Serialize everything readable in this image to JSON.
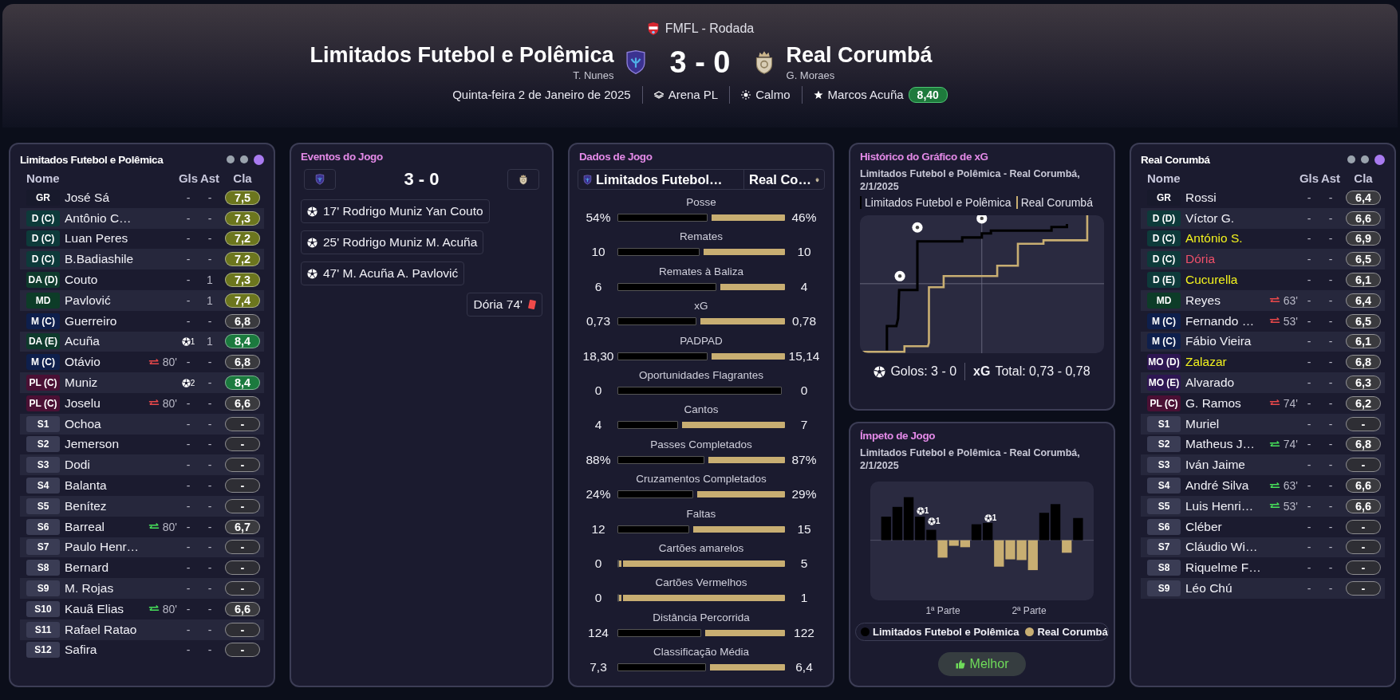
{
  "header": {
    "competition": "FMFL - Rodada",
    "home": {
      "name": "Limitados Futebol e Polêmica",
      "manager": "T. Nunes"
    },
    "score": "3 - 0",
    "away": {
      "name": "Real Corumbá",
      "manager": "G. Moraes"
    },
    "info": [
      {
        "kind": "date",
        "text": "Quinta-feira 2 de Janeiro de 2025"
      },
      {
        "kind": "stadium",
        "text": "Arena PL"
      },
      {
        "kind": "weather",
        "text": "Calmo"
      },
      {
        "kind": "motm",
        "text": "Marcos Acuña",
        "rating": "8,40"
      }
    ]
  },
  "home_lineup": {
    "title": "Limitados Futebol e Polêmica",
    "page_dots": [
      {
        "selected": false
      },
      {
        "selected": false
      },
      {
        "selected": true
      }
    ],
    "columns": [
      "Nome",
      "Gls",
      "Ast",
      "Cla"
    ],
    "players": [
      {
        "pos": {
          "text": "GR",
          "color": "#181a2c"
        },
        "name": "José Sá",
        "yellow_card": false,
        "red_card": false,
        "goal_icon": false,
        "goals": "-",
        "assists": "-",
        "rating": {
          "text": "7,5",
          "color": "#6c761e"
        }
      },
      {
        "pos": {
          "text": "D (C)",
          "color": "#0d3a3a"
        },
        "name": "Antônio C…",
        "yellow_card": false,
        "red_card": false,
        "goal_icon": false,
        "goals": "-",
        "assists": "-",
        "rating": {
          "text": "7,3",
          "color": "#6c761e"
        }
      },
      {
        "pos": {
          "text": "D (C)",
          "color": "#0d3a3a"
        },
        "name": "Luan Peres",
        "yellow_card": false,
        "red_card": false,
        "goal_icon": false,
        "goals": "-",
        "assists": "-",
        "rating": {
          "text": "7,2",
          "color": "#6c761e"
        }
      },
      {
        "pos": {
          "text": "D (C)",
          "color": "#0d3a3a"
        },
        "name": "B.Badiashile",
        "yellow_card": false,
        "red_card": false,
        "goal_icon": false,
        "goals": "-",
        "assists": "-",
        "rating": {
          "text": "7,2",
          "color": "#6c761e"
        }
      },
      {
        "pos": {
          "text": "DA (D)",
          "color": "#0e3a2c"
        },
        "name": "Couto",
        "yellow_card": false,
        "red_card": false,
        "goal_icon": false,
        "goals": "-",
        "assists": "1",
        "rating": {
          "text": "7,3",
          "color": "#6c761e"
        }
      },
      {
        "pos": {
          "text": "MD",
          "color": "#0d3c28"
        },
        "name": "Pavlović",
        "yellow_card": false,
        "red_card": false,
        "goal_icon": false,
        "goals": "-",
        "assists": "1",
        "rating": {
          "text": "7,4",
          "color": "#6c761e"
        }
      },
      {
        "pos": {
          "text": "M (C)",
          "color": "#0e1f4c"
        },
        "name": "Guerreiro",
        "yellow_card": false,
        "red_card": false,
        "goal_icon": false,
        "goals": "-",
        "assists": "-",
        "rating": {
          "text": "6,8",
          "color": "#3a3a3e"
        }
      },
      {
        "pos": {
          "text": "DA (E)",
          "color": "#0e3a2c"
        },
        "name": "Acuña",
        "yellow_card": false,
        "red_card": false,
        "goal_icon": true,
        "goals": "1",
        "assists": "1",
        "rating": {
          "text": "8,4",
          "color": "#1b7a3e"
        }
      },
      {
        "pos": {
          "text": "M (C)",
          "color": "#0e1f4c"
        },
        "name": "Otávio",
        "yellow_card": false,
        "red_card": false,
        "sub": {
          "minute": "80'",
          "incoming": false
        },
        "goal_icon": false,
        "goals": "-",
        "assists": "-",
        "rating": {
          "text": "6,8",
          "color": "#3a3a3e"
        }
      },
      {
        "pos": {
          "text": "PL (C)",
          "color": "#4a1034"
        },
        "name": "Muniz",
        "yellow_card": false,
        "red_card": false,
        "goal_icon": true,
        "goals": "2",
        "assists": "-",
        "rating": {
          "text": "8,4",
          "color": "#1b7a3e"
        }
      },
      {
        "pos": {
          "text": "PL (C)",
          "color": "#4a1034"
        },
        "name": "Joselu",
        "yellow_card": false,
        "red_card": false,
        "sub": {
          "minute": "80'",
          "incoming": false
        },
        "goal_icon": false,
        "goals": "-",
        "assists": "-",
        "rating": {
          "text": "6,6",
          "color": "#3a3a3e"
        }
      },
      {
        "pos": {
          "text": "S1",
          "color": "#3a3c54"
        },
        "name": "Ochoa",
        "yellow_card": false,
        "red_card": false,
        "goal_icon": false,
        "goals": "-",
        "assists": "-",
        "rating": {
          "text": "-",
          "color": "#2e2e34"
        }
      },
      {
        "pos": {
          "text": "S2",
          "color": "#3a3c54"
        },
        "name": "Jemerson",
        "yellow_card": false,
        "red_card": false,
        "goal_icon": false,
        "goals": "-",
        "assists": "-",
        "rating": {
          "text": "-",
          "color": "#2e2e34"
        }
      },
      {
        "pos": {
          "text": "S3",
          "color": "#3a3c54"
        },
        "name": "Dodi",
        "yellow_card": false,
        "red_card": false,
        "goal_icon": false,
        "goals": "-",
        "assists": "-",
        "rating": {
          "text": "-",
          "color": "#2e2e34"
        }
      },
      {
        "pos": {
          "text": "S4",
          "color": "#3a3c54"
        },
        "name": "Balanta",
        "yellow_card": false,
        "red_card": false,
        "goal_icon": false,
        "goals": "-",
        "assists": "-",
        "rating": {
          "text": "-",
          "color": "#2e2e34"
        }
      },
      {
        "pos": {
          "text": "S5",
          "color": "#3a3c54"
        },
        "name": "Benítez",
        "yellow_card": false,
        "red_card": false,
        "goal_icon": false,
        "goals": "-",
        "assists": "-",
        "rating": {
          "text": "-",
          "color": "#2e2e34"
        }
      },
      {
        "pos": {
          "text": "S6",
          "color": "#3a3c54"
        },
        "name": "Barreal",
        "yellow_card": false,
        "red_card": false,
        "sub": {
          "minute": "80'",
          "incoming": true
        },
        "goal_icon": false,
        "goals": "-",
        "assists": "-",
        "rating": {
          "text": "6,7",
          "color": "#3a3a3e"
        }
      },
      {
        "pos": {
          "text": "S7",
          "color": "#3a3c54"
        },
        "name": "Paulo Henr…",
        "yellow_card": false,
        "red_card": false,
        "goal_icon": false,
        "goals": "-",
        "assists": "-",
        "rating": {
          "text": "-",
          "color": "#2e2e34"
        }
      },
      {
        "pos": {
          "text": "S8",
          "color": "#3a3c54"
        },
        "name": "Bernard",
        "yellow_card": false,
        "red_card": false,
        "goal_icon": false,
        "goals": "-",
        "assists": "-",
        "rating": {
          "text": "-",
          "color": "#2e2e34"
        }
      },
      {
        "pos": {
          "text": "S9",
          "color": "#3a3c54"
        },
        "name": "M. Rojas",
        "yellow_card": false,
        "red_card": false,
        "goal_icon": false,
        "goals": "-",
        "assists": "-",
        "rating": {
          "text": "-",
          "color": "#2e2e34"
        }
      },
      {
        "pos": {
          "text": "S10",
          "color": "#3a3c54"
        },
        "name": "Kauã Elias",
        "yellow_card": false,
        "red_card": false,
        "sub": {
          "minute": "80'",
          "incoming": true
        },
        "goal_icon": false,
        "goals": "-",
        "assists": "-",
        "rating": {
          "text": "6,6",
          "color": "#3a3a3e"
        }
      },
      {
        "pos": {
          "text": "S11",
          "color": "#3a3c54"
        },
        "name": "Rafael Ratao",
        "yellow_card": false,
        "red_card": false,
        "goal_icon": false,
        "goals": "-",
        "assists": "-",
        "rating": {
          "text": "-",
          "color": "#2e2e34"
        }
      },
      {
        "pos": {
          "text": "S12",
          "color": "#3a3c54"
        },
        "name": "Safira",
        "yellow_card": false,
        "red_card": false,
        "goal_icon": false,
        "goals": "-",
        "assists": "-",
        "rating": {
          "text": "-",
          "color": "#2e2e34"
        }
      }
    ]
  },
  "events": {
    "title": "Eventos do Jogo",
    "score": "3 - 0",
    "items": [
      {
        "kind": "goal",
        "away": false,
        "text": "17' Rodrigo Muniz Yan Couto"
      },
      {
        "kind": "goal",
        "away": false,
        "text": "25' Rodrigo Muniz M. Acuña"
      },
      {
        "kind": "goal",
        "away": false,
        "text": "47' M. Acuña A. Pavlović"
      },
      {
        "kind": "red_card",
        "away": true,
        "text": "Dória 74'"
      }
    ]
  },
  "match_stats": {
    "title": "Dados de Jogo",
    "home_team": "Limitados Futebol…",
    "away_team": "Real Co…",
    "stats": [
      {
        "label": "Posse",
        "home": "54%",
        "away": "46%",
        "level": 0.54
      },
      {
        "label": "Remates",
        "home": "10",
        "away": "10",
        "level": 0.49
      },
      {
        "label": "Remates à Baliza",
        "home": "6",
        "away": "4",
        "level": 0.59
      },
      {
        "label": "xG",
        "home": "0,73",
        "away": "0,78",
        "level": 0.47
      },
      {
        "label": "PADPAD",
        "home": "18,30",
        "away": "15,14",
        "level": 0.54
      },
      {
        "label": "Oportunidades Flagrantes",
        "home": "0",
        "away": "0",
        "level": 0.98
      },
      {
        "label": "Cantos",
        "home": "4",
        "away": "7",
        "level": 0.36
      },
      {
        "label": "Passes Completados",
        "home": "88%",
        "away": "87%",
        "level": 0.52
      },
      {
        "label": "Cruzamentos Completados",
        "home": "24%",
        "away": "29%",
        "level": 0.45
      },
      {
        "label": "Faltas",
        "home": "12",
        "away": "15",
        "level": 0.43
      },
      {
        "label": "Cartões amarelos",
        "home": "0",
        "away": "5",
        "level": 0.01
      },
      {
        "label": "Cartões Vermelhos",
        "home": "0",
        "away": "1",
        "level": 0.01
      },
      {
        "label": "Distância Percorrida",
        "home": "124",
        "away": "122",
        "level": 0.5
      },
      {
        "label": "Classificação Média",
        "home": "7,3",
        "away": "6,4",
        "level": 0.53
      }
    ]
  },
  "xg_history": {
    "title": "Histórico do Gráfico de xG",
    "subtitle": "Limitados Futebol e Polêmica - Real Corumbá, 2/1/2025",
    "legend": [
      {
        "label": "Limitados Futebol e Polêmica",
        "color": "#000000"
      },
      {
        "label": "Real Corumbá",
        "color": "#c8ae72"
      }
    ],
    "goals": "Golos: 3 - 0",
    "xg_total": "**xG** Total: 0,73 - 0,78"
  },
  "momentum": {
    "title": "Ímpeto de Jogo",
    "subtitle": "Limitados Futebol e Polêmica - Real Corumbá, 2/1/2025",
    "goal_markers": [
      {
        "count": "1"
      },
      {
        "count": "1"
      },
      {
        "count": "1"
      }
    ],
    "halves": [
      "1ª Parte",
      "2ª Parte"
    ],
    "legend": [
      {
        "label": "Limitados Futebol e Polêmica",
        "color": "#000000"
      },
      {
        "label": "Real Corumbá",
        "color": "#c8ae72"
      }
    ],
    "button": "Melhor"
  },
  "away_lineup": {
    "title": "Real Corumbá",
    "page_dots": [
      {
        "selected": false
      },
      {
        "selected": false
      },
      {
        "selected": true
      }
    ],
    "columns": [
      "Nome",
      "Gls",
      "Ast",
      "Cla"
    ],
    "players": [
      {
        "pos": {
          "text": "GR",
          "color": "#181a2c"
        },
        "name": "Rossi",
        "yellow_card": false,
        "red_card": false,
        "goal_icon": false,
        "goals": "-",
        "assists": "-",
        "rating": {
          "text": "6,4",
          "color": "#3a3a3e"
        }
      },
      {
        "pos": {
          "text": "D (D)",
          "color": "#0d3a3a"
        },
        "name": "Víctor G.",
        "yellow_card": false,
        "red_card": false,
        "goal_icon": false,
        "goals": "-",
        "assists": "-",
        "rating": {
          "text": "6,6",
          "color": "#3a3a3e"
        }
      },
      {
        "pos": {
          "text": "D (C)",
          "color": "#0d3a3a"
        },
        "name": "António S.",
        "yellow_card": true,
        "red_card": false,
        "goal_icon": false,
        "goals": "-",
        "assists": "-",
        "rating": {
          "text": "6,9",
          "color": "#3a3a3e"
        }
      },
      {
        "pos": {
          "text": "D (C)",
          "color": "#0d3a3a"
        },
        "name": "Dória",
        "red_card": true,
        "goal_icon": false,
        "goals": "-",
        "assists": "-",
        "rating": {
          "text": "6,5",
          "color": "#3a3a3e"
        }
      },
      {
        "pos": {
          "text": "D (E)",
          "color": "#0d3a3a"
        },
        "name": "Cucurella",
        "yellow_card": true,
        "red_card": false,
        "goal_icon": false,
        "goals": "-",
        "assists": "-",
        "rating": {
          "text": "6,1",
          "color": "#3a3a3e"
        }
      },
      {
        "pos": {
          "text": "MD",
          "color": "#0d3c28"
        },
        "name": "Reyes",
        "yellow_card": false,
        "red_card": false,
        "sub": {
          "minute": "63'",
          "incoming": false
        },
        "goal_icon": false,
        "goals": "-",
        "assists": "-",
        "rating": {
          "text": "6,4",
          "color": "#3a3a3e"
        }
      },
      {
        "pos": {
          "text": "M (C)",
          "color": "#0e1f4c"
        },
        "name": "Fernando …",
        "yellow_card": false,
        "red_card": false,
        "sub": {
          "minute": "53'",
          "incoming": false
        },
        "goal_icon": false,
        "goals": "-",
        "assists": "-",
        "rating": {
          "text": "6,5",
          "color": "#3a3a3e"
        }
      },
      {
        "pos": {
          "text": "M (C)",
          "color": "#0e1f4c"
        },
        "name": "Fábio Vieira",
        "yellow_card": false,
        "red_card": false,
        "goal_icon": false,
        "goals": "-",
        "assists": "-",
        "rating": {
          "text": "6,1",
          "color": "#3a3a3e"
        }
      },
      {
        "pos": {
          "text": "MO (D)",
          "color": "#2e1652"
        },
        "name": "Zalazar",
        "yellow_card": true,
        "red_card": false,
        "goal_icon": false,
        "goals": "-",
        "assists": "-",
        "rating": {
          "text": "6,8",
          "color": "#3a3a3e"
        }
      },
      {
        "pos": {
          "text": "MO (E)",
          "color": "#2e1652"
        },
        "name": "Alvarado",
        "yellow_card": false,
        "red_card": false,
        "goal_icon": false,
        "goals": "-",
        "assists": "-",
        "rating": {
          "text": "6,3",
          "color": "#3a3a3e"
        }
      },
      {
        "pos": {
          "text": "PL (C)",
          "color": "#4a1034"
        },
        "name": "G. Ramos",
        "yellow_card": false,
        "red_card": false,
        "sub": {
          "minute": "74'",
          "incoming": false
        },
        "goal_icon": false,
        "goals": "-",
        "assists": "-",
        "rating": {
          "text": "6,2",
          "color": "#3a3a3e"
        }
      },
      {
        "pos": {
          "text": "S1",
          "color": "#3a3c54"
        },
        "name": "Muriel",
        "yellow_card": false,
        "red_card": false,
        "goal_icon": false,
        "goals": "-",
        "assists": "-",
        "rating": {
          "text": "-",
          "color": "#2e2e34"
        }
      },
      {
        "pos": {
          "text": "S2",
          "color": "#3a3c54"
        },
        "name": "Matheus J…",
        "yellow_card": false,
        "red_card": false,
        "sub": {
          "minute": "74'",
          "incoming": true
        },
        "goal_icon": false,
        "goals": "-",
        "assists": "-",
        "rating": {
          "text": "6,8",
          "color": "#3a3a3e"
        }
      },
      {
        "pos": {
          "text": "S3",
          "color": "#3a3c54"
        },
        "name": "Iván Jaime",
        "yellow_card": false,
        "red_card": false,
        "goal_icon": false,
        "goals": "-",
        "assists": "-",
        "rating": {
          "text": "-",
          "color": "#2e2e34"
        }
      },
      {
        "pos": {
          "text": "S4",
          "color": "#3a3c54"
        },
        "name": "André Silva",
        "yellow_card": false,
        "red_card": false,
        "sub": {
          "minute": "63'",
          "incoming": true
        },
        "goal_icon": false,
        "goals": "-",
        "assists": "-",
        "rating": {
          "text": "6,6",
          "color": "#3a3a3e"
        }
      },
      {
        "pos": {
          "text": "S5",
          "color": "#3a3c54"
        },
        "name": "Luis Henri…",
        "yellow_card": false,
        "red_card": false,
        "sub": {
          "minute": "53'",
          "incoming": true
        },
        "goal_icon": false,
        "goals": "-",
        "assists": "-",
        "rating": {
          "text": "6,6",
          "color": "#3a3a3e"
        }
      },
      {
        "pos": {
          "text": "S6",
          "color": "#3a3c54"
        },
        "name": "Cléber",
        "yellow_card": false,
        "red_card": false,
        "goal_icon": false,
        "goals": "-",
        "assists": "-",
        "rating": {
          "text": "-",
          "color": "#2e2e34"
        }
      },
      {
        "pos": {
          "text": "S7",
          "color": "#3a3c54"
        },
        "name": "Cláudio Wi…",
        "yellow_card": false,
        "red_card": false,
        "goal_icon": false,
        "goals": "-",
        "assists": "-",
        "rating": {
          "text": "-",
          "color": "#2e2e34"
        }
      },
      {
        "pos": {
          "text": "S8",
          "color": "#3a3c54"
        },
        "name": "Riquelme F…",
        "yellow_card": false,
        "red_card": false,
        "goal_icon": false,
        "goals": "-",
        "assists": "-",
        "rating": {
          "text": "-",
          "color": "#2e2e34"
        }
      },
      {
        "pos": {
          "text": "S9",
          "color": "#3a3c54"
        },
        "name": "Léo Chú",
        "yellow_card": false,
        "red_card": false,
        "goal_icon": false,
        "goals": "-",
        "assists": "-",
        "rating": {
          "text": "-",
          "color": "#2e2e34"
        }
      }
    ]
  }
}
